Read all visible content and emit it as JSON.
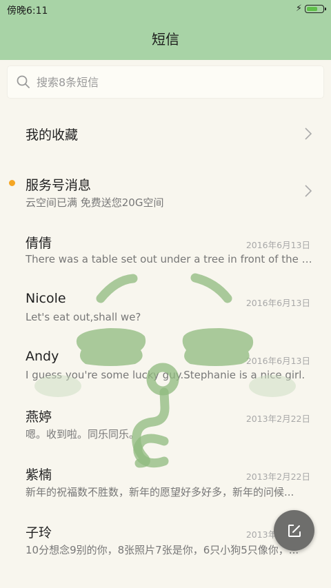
{
  "status_bar": {
    "time": "傍晚6:11",
    "battery_level": 0.7
  },
  "header": {
    "title": "短信"
  },
  "search": {
    "placeholder": "搜索8条短信"
  },
  "favorites": {
    "label": "我的收藏"
  },
  "service": {
    "title": "服务号消息",
    "subtitle": "云空间已满 免费送您20G空间",
    "unread": true
  },
  "conversations": [
    {
      "name": "倩倩",
      "date": "2016年6月13日",
      "preview": "There was a table set out under a tree in front of the ho..."
    },
    {
      "name": "Nicole",
      "date": "2016年6月13日",
      "preview": "Let's eat out,shall we?"
    },
    {
      "name": "Andy",
      "date": "2016年6月13日",
      "preview": "I guess you're some lucky guy.Stephanie is a nice girl."
    },
    {
      "name": "燕婷",
      "date": "2013年2月22日",
      "preview": "嗯。收到啦。同乐同乐。"
    },
    {
      "name": "紫楠",
      "date": "2013年2月22日",
      "preview": "新年的祝福数不胜数，新年的愿望好多好多，新年的问候..."
    },
    {
      "name": "子玲",
      "date": "2013年2月22日",
      "preview": "10分想念9别的你，8张照片7张是你，6只小狗5只像你，..."
    }
  ],
  "fab": {
    "icon": "compose-icon"
  },
  "icons": {
    "search": "search-icon",
    "chevron": "chevron-right-icon",
    "charging": "bolt-icon",
    "battery": "battery-icon"
  },
  "colors": {
    "header_bg": "#a8d3a6",
    "background": "#f8f6ee",
    "unread_dot": "#f5a623",
    "overlay_face": "#8fba7e",
    "fab_bg": "#6e6e6c"
  }
}
